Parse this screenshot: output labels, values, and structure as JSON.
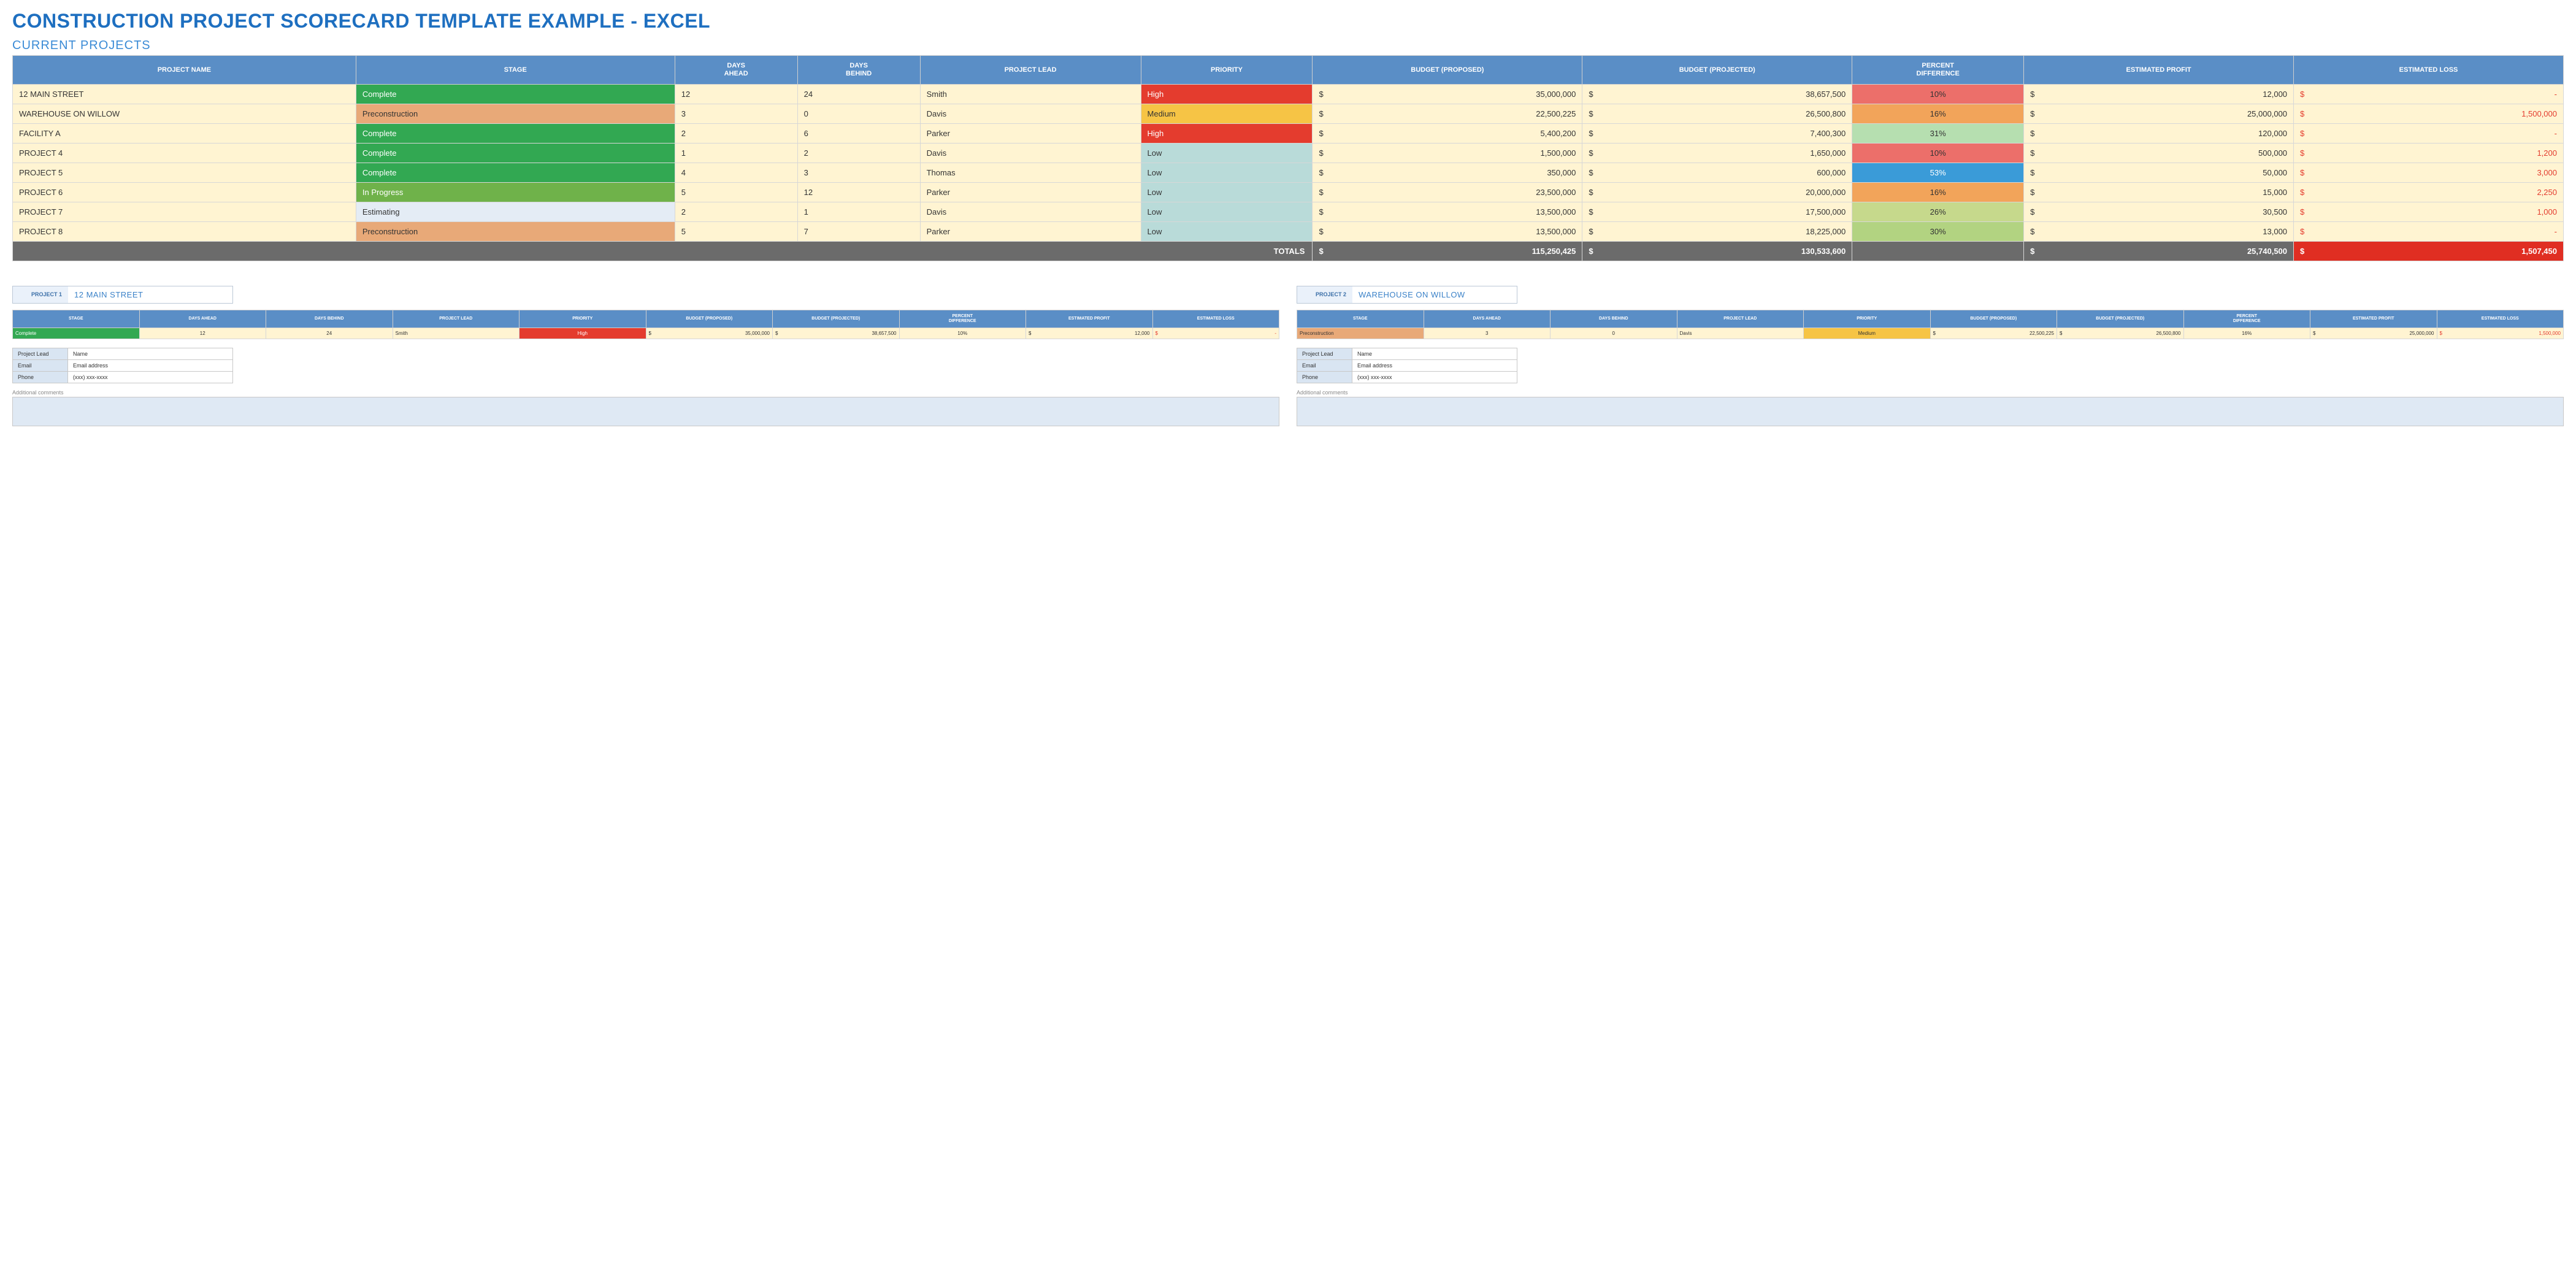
{
  "title": "CONSTRUCTION PROJECT SCORECARD TEMPLATE EXAMPLE - EXCEL",
  "subtitle": "CURRENT PROJECTS",
  "columns": [
    "PROJECT NAME",
    "STAGE",
    "DAYS AHEAD",
    "DAYS BEHIND",
    "PROJECT LEAD",
    "PRIORITY",
    "BUDGET (PROPOSED)",
    "BUDGET (PROJECTED)",
    "PERCENT DIFFERENCE",
    "ESTIMATED PROFIT",
    "ESTIMATED LOSS"
  ],
  "rows": [
    {
      "name": "12 MAIN STREET",
      "stage": "Complete",
      "stage_cls": "stage-complete",
      "ahead": "12",
      "behind": "24",
      "lead": "Smith",
      "priority": "High",
      "prio_cls": "prio-high",
      "bud_prop": "35,000,000",
      "bud_proj": "38,657,500",
      "pct": "10%",
      "pct_cls": "pd-red",
      "profit": "12,000",
      "loss": "-"
    },
    {
      "name": "WAREHOUSE ON WILLOW",
      "stage": "Preconstruction",
      "stage_cls": "stage-precon",
      "ahead": "3",
      "behind": "0",
      "lead": "Davis",
      "priority": "Medium",
      "prio_cls": "prio-medium",
      "bud_prop": "22,500,225",
      "bud_proj": "26,500,800",
      "pct": "16%",
      "pct_cls": "pd-orange",
      "profit": "25,000,000",
      "loss": "1,500,000"
    },
    {
      "name": "FACILITY A",
      "stage": "Complete",
      "stage_cls": "stage-complete",
      "ahead": "2",
      "behind": "6",
      "lead": "Parker",
      "priority": "High",
      "prio_cls": "prio-high",
      "bud_prop": "5,400,200",
      "bud_proj": "7,400,300",
      "pct": "31%",
      "pct_cls": "pd-lightgreen",
      "profit": "120,000",
      "loss": "-"
    },
    {
      "name": "PROJECT 4",
      "stage": "Complete",
      "stage_cls": "stage-complete",
      "ahead": "1",
      "behind": "2",
      "lead": "Davis",
      "priority": "Low",
      "prio_cls": "prio-low",
      "bud_prop": "1,500,000",
      "bud_proj": "1,650,000",
      "pct": "10%",
      "pct_cls": "pd-red",
      "profit": "500,000",
      "loss": "1,200"
    },
    {
      "name": "PROJECT 5",
      "stage": "Complete",
      "stage_cls": "stage-complete",
      "ahead": "4",
      "behind": "3",
      "lead": "Thomas",
      "priority": "Low",
      "prio_cls": "prio-low",
      "bud_prop": "350,000",
      "bud_proj": "600,000",
      "pct": "53%",
      "pct_cls": "pd-blue",
      "profit": "50,000",
      "loss": "3,000"
    },
    {
      "name": "PROJECT 6",
      "stage": "In Progress",
      "stage_cls": "stage-inprogress",
      "ahead": "5",
      "behind": "12",
      "lead": "Parker",
      "priority": "Low",
      "prio_cls": "prio-low",
      "bud_prop": "23,500,000",
      "bud_proj": "20,000,000",
      "pct": "16%",
      "pct_cls": "pd-orange",
      "profit": "15,000",
      "loss": "2,250"
    },
    {
      "name": "PROJECT 7",
      "stage": "Estimating",
      "stage_cls": "stage-estimating",
      "ahead": "2",
      "behind": "1",
      "lead": "Davis",
      "priority": "Low",
      "prio_cls": "prio-low",
      "bud_prop": "13,500,000",
      "bud_proj": "17,500,000",
      "pct": "26%",
      "pct_cls": "pd-olive",
      "profit": "30,500",
      "loss": "1,000"
    },
    {
      "name": "PROJECT 8",
      "stage": "Preconstruction",
      "stage_cls": "stage-precon",
      "ahead": "5",
      "behind": "7",
      "lead": "Parker",
      "priority": "Low",
      "prio_cls": "prio-low",
      "bud_prop": "13,500,000",
      "bud_proj": "18,225,000",
      "pct": "30%",
      "pct_cls": "pd-yellowgreen",
      "profit": "13,000",
      "loss": "-"
    }
  ],
  "totals": {
    "label": "TOTALS",
    "bud_prop": "115,250,425",
    "bud_proj": "130,533,600",
    "profit": "25,740,500",
    "loss": "1,507,450"
  },
  "detail_columns": [
    "STAGE",
    "DAYS AHEAD",
    "DAYS BEHIND",
    "PROJECT LEAD",
    "PRIORITY",
    "BUDGET (PROPOSED)",
    "BUDGET (PROJECTED)",
    "PERCENT DIFFERENCE",
    "ESTIMATED PROFIT",
    "ESTIMATED LOSS"
  ],
  "details": [
    {
      "header_label": "PROJECT 1",
      "header_value": "12 MAIN STREET",
      "row": {
        "stage": "Complete",
        "stage_cls": "stage-complete",
        "ahead": "12",
        "behind": "24",
        "lead": "Smith",
        "priority": "High",
        "prio_cls": "prio-high",
        "bud_prop": "35,000,000",
        "bud_proj": "38,657,500",
        "pct": "10%",
        "profit": "12,000",
        "loss": "-"
      }
    },
    {
      "header_label": "PROJECT 2",
      "header_value": "WAREHOUSE ON WILLOW",
      "row": {
        "stage": "Preconstruction",
        "stage_cls": "stage-precon",
        "ahead": "3",
        "behind": "0",
        "lead": "Davis",
        "priority": "Medium",
        "prio_cls": "prio-medium",
        "bud_prop": "22,500,225",
        "bud_proj": "26,500,800",
        "pct": "16%",
        "profit": "25,000,000",
        "loss": "1,500,000"
      }
    }
  ],
  "contact": {
    "rows": [
      {
        "k": "Project Lead",
        "v": "Name"
      },
      {
        "k": "Email",
        "v": "Email address"
      },
      {
        "k": "Phone",
        "v": "(xxx) xxx-xxxx"
      }
    ]
  },
  "comments_label": "Additional comments",
  "currency": "$"
}
